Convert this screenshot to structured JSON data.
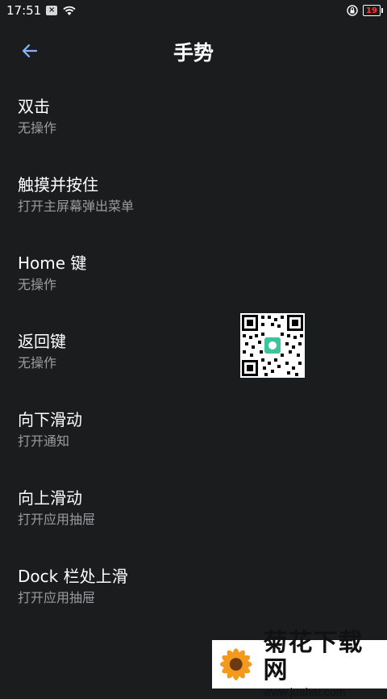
{
  "status_bar": {
    "time": "17:51",
    "notification_icon": "x-icon",
    "battery": "19",
    "colors": {
      "battery_low": "#ff3b30"
    }
  },
  "header": {
    "title": "手势",
    "back_icon": "arrow-left-icon",
    "back_color": "#8ab4f8"
  },
  "items": [
    {
      "title": "双击",
      "subtitle": "无操作"
    },
    {
      "title": "触摸并按住",
      "subtitle": "打开主屏幕弹出菜单"
    },
    {
      "title": "Home 键",
      "subtitle": "无操作"
    },
    {
      "title": "返回键",
      "subtitle": "无操作"
    },
    {
      "title": "向下滑动",
      "subtitle": "打开通知"
    },
    {
      "title": "向上滑动",
      "subtitle": "打开应用抽屉"
    },
    {
      "title": "Dock 栏处上滑",
      "subtitle": "打开应用抽屉"
    }
  ],
  "watermark": {
    "text": "菊花下载网",
    "url": "www.juahar.com"
  },
  "colors": {
    "background": "#1b1c1e",
    "subtitle": "#9b9ca0"
  }
}
